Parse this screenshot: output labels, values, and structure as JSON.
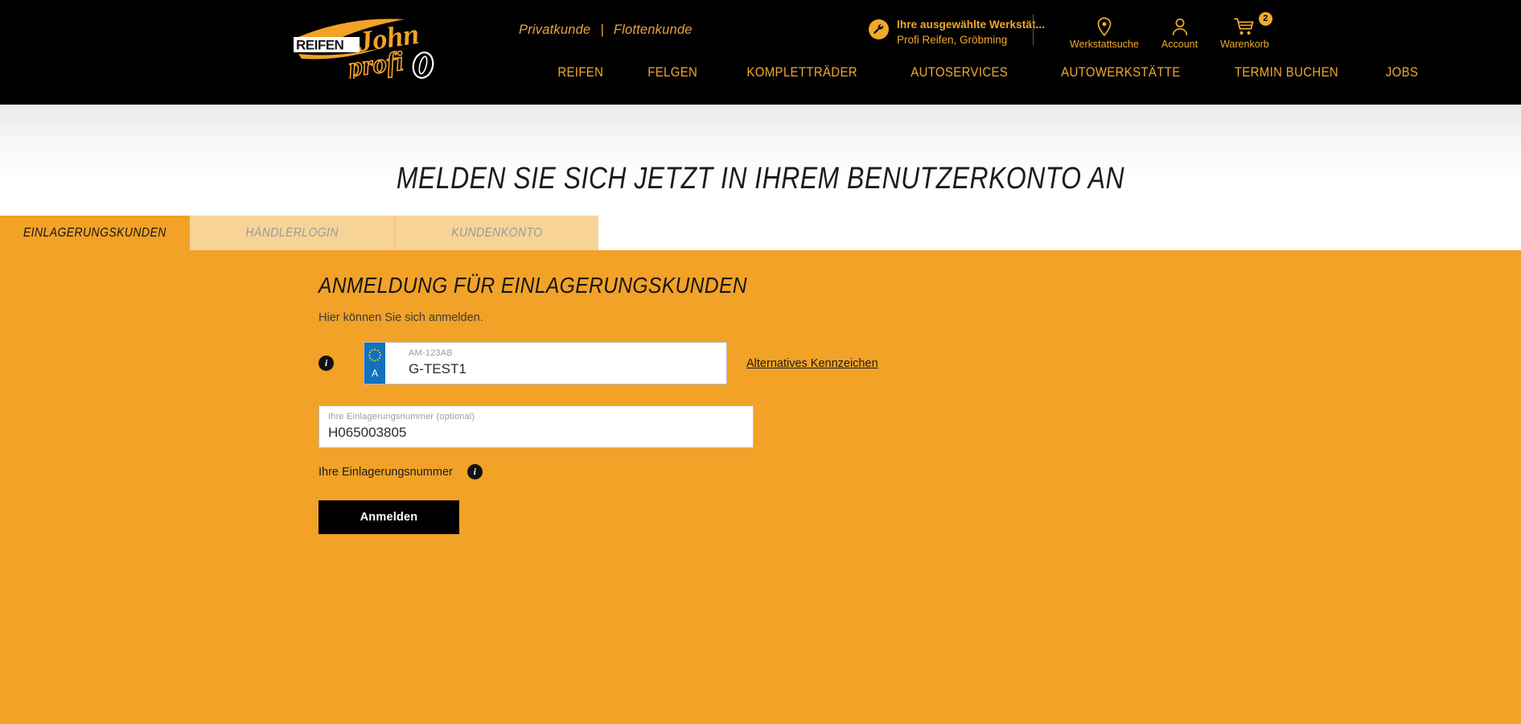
{
  "brand": {
    "logo_text_primary": "REIFEN",
    "logo_text_script": "John",
    "logo_text_sub": "profi",
    "accent_color": "#F2A227",
    "header_bg": "#000000"
  },
  "header": {
    "customer_links": {
      "private_label": "Privatkunde",
      "separator": "|",
      "fleet_label": "Flottenkunde"
    },
    "workshop": {
      "icon": "wrench-icon",
      "title": "Ihre ausgewählte Werkstät...",
      "name": "Profi Reifen, Gröbming"
    },
    "utilities": [
      {
        "icon": "map-pin-icon",
        "label": "Werkstattsuche",
        "badge": null
      },
      {
        "icon": "user-icon",
        "label": "Account",
        "badge": null
      },
      {
        "icon": "cart-icon",
        "label": "Warenkorb",
        "badge": "2"
      }
    ],
    "nav": [
      {
        "label": "REIFEN"
      },
      {
        "label": "FELGEN"
      },
      {
        "label": "KOMPLETTRÄDER"
      },
      {
        "label": "AUTOSERVICES"
      },
      {
        "label": "AUTOWERKSTÄTTE"
      },
      {
        "label": "TERMIN BUCHEN"
      },
      {
        "label": "JOBS"
      }
    ]
  },
  "page": {
    "title": "MELDEN SIE SICH JETZT IN IHREM BENUTZERKONTO AN"
  },
  "tabs": [
    {
      "label": "EINLAGERUNGSKUNDEN",
      "active": true
    },
    {
      "label": "HÄNDLERLOGIN",
      "active": false
    },
    {
      "label": "KUNDENKONTO",
      "active": false
    }
  ],
  "form": {
    "heading": "ANMELDUNG FÜR EINLAGERUNGSKUNDEN",
    "subheading": "Hier können Sie sich anmelden.",
    "plate_info_icon": "info-icon",
    "plate_field": {
      "eu_country_code": "A",
      "eu_badge_color": "#1272BF",
      "label": "AM-123AB",
      "value": "G-TEST1"
    },
    "alternative_plate_link": "Alternatives Kennzeichen",
    "storage_field": {
      "label": "Ihre Einlagerungsnummer (optional)",
      "value": "H065003805"
    },
    "hint": {
      "text": "Ihre Einlagerungsnummer",
      "icon": "info-icon"
    },
    "submit_label": "Anmelden"
  }
}
